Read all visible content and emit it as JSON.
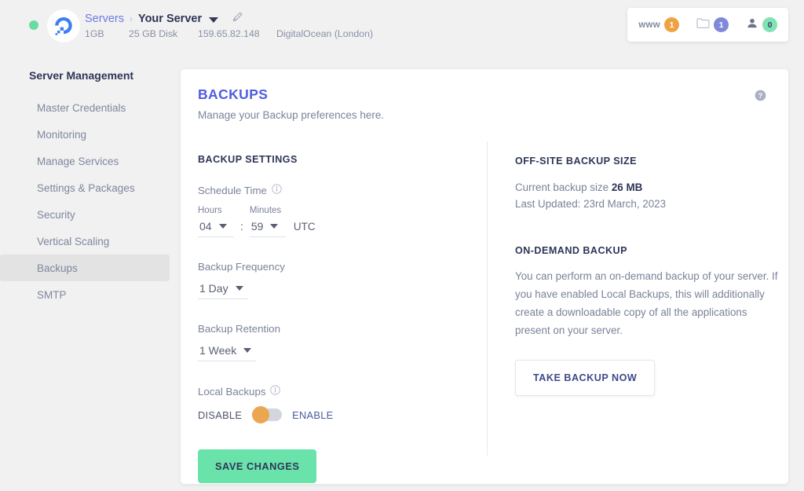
{
  "topbar": {
    "status": "online",
    "logo_icon": "digitalocean-logo",
    "breadcrumb": {
      "parent": "Servers",
      "separator": "›",
      "current": "Your Server",
      "dropdown_icon": "caret-down-icon",
      "edit_icon": "pencil-icon"
    },
    "meta": {
      "ram": "1GB",
      "disk": "25 GB Disk",
      "ip": "159.65.82.148",
      "provider": "DigitalOcean (London)"
    },
    "badges": [
      {
        "label": "www",
        "count": "1",
        "icon": "www-icon",
        "color": "#efa244"
      },
      {
        "label": "",
        "count": "1",
        "icon": "folder-icon",
        "color": "#8088d9"
      },
      {
        "label": "",
        "count": "0",
        "icon": "user-icon",
        "color": "#80e2b5"
      }
    ]
  },
  "sidebar": {
    "title": "Server Management",
    "items": [
      {
        "label": "Master Credentials",
        "active": false
      },
      {
        "label": "Monitoring",
        "active": false
      },
      {
        "label": "Manage Services",
        "active": false
      },
      {
        "label": "Settings & Packages",
        "active": false
      },
      {
        "label": "Security",
        "active": false
      },
      {
        "label": "Vertical Scaling",
        "active": false
      },
      {
        "label": "Backups",
        "active": true
      },
      {
        "label": "SMTP",
        "active": false
      }
    ]
  },
  "card": {
    "title": "BACKUPS",
    "subtitle": "Manage your Backup preferences here.",
    "help_icon": "help-circle-icon",
    "left": {
      "section_title": "BACKUP SETTINGS",
      "schedule_time": {
        "label": "Schedule Time",
        "info_icon": "info-circle-icon",
        "hours_label": "Hours",
        "minutes_label": "Minutes",
        "hours_value": "04",
        "minutes_value": "59",
        "separator": ":",
        "timezone": "UTC"
      },
      "backup_frequency": {
        "label": "Backup Frequency",
        "value": "1 Day"
      },
      "backup_retention": {
        "label": "Backup Retention",
        "value": "1 Week"
      },
      "local_backups": {
        "label": "Local Backups",
        "info_icon": "info-circle-icon",
        "off_label": "DISABLE",
        "on_label": "ENABLE",
        "state": "DISABLE",
        "knob_color": "#eba652"
      },
      "save_button": "SAVE CHANGES"
    },
    "right": {
      "offsite_title": "OFF-SITE BACKUP SIZE",
      "current_size_label": "Current backup size",
      "current_size_value": "26 MB",
      "last_updated": "Last Updated: 23rd March, 2023",
      "ondemand_title": "ON-DEMAND BACKUP",
      "ondemand_text": "You can perform an on-demand backup of your server. If you have enabled Local Backups, this will additionally create a downloadable copy of all the applications present on your server.",
      "take_backup_button": "TAKE BACKUP NOW"
    }
  }
}
